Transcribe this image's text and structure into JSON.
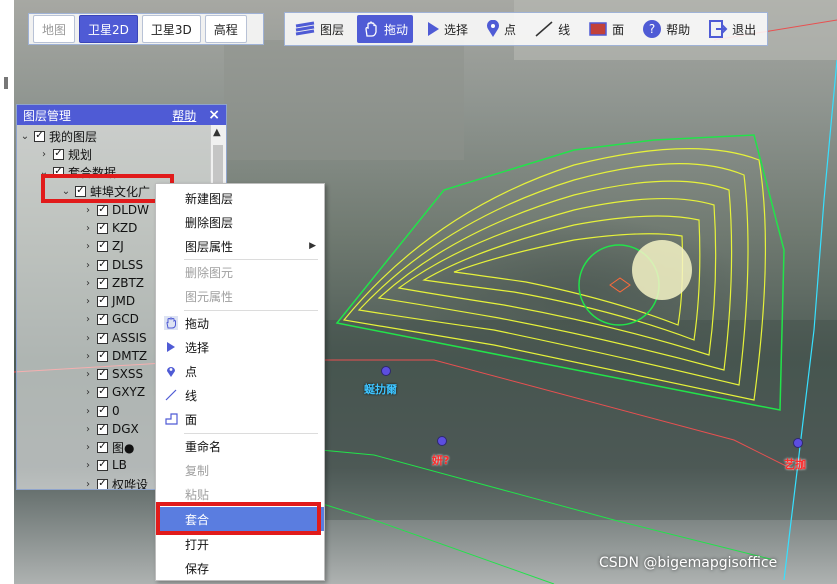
{
  "map_mode": {
    "items": [
      {
        "label": "地图",
        "state": "disabled"
      },
      {
        "label": "卫星2D",
        "state": "active"
      },
      {
        "label": "卫星3D",
        "state": "normal"
      },
      {
        "label": "高程",
        "state": "normal"
      }
    ]
  },
  "toolbar": {
    "layers_label": "图层",
    "pan_label": "拖动",
    "select_label": "选择",
    "point_label": "点",
    "line_label": "线",
    "area_label": "面",
    "help_label": "帮助",
    "exit_label": "退出"
  },
  "layer_panel": {
    "title": "图层管理",
    "help_label": "帮助",
    "close_label": "×",
    "tree": [
      {
        "label": "我的图层",
        "level": 0
      },
      {
        "label": "规划",
        "level": 1
      },
      {
        "label": "套合数据",
        "level": 1
      },
      {
        "label": "蚌埠文化广",
        "level": 2
      },
      {
        "label": "DLDW",
        "level": 3
      },
      {
        "label": "KZD",
        "level": 3
      },
      {
        "label": "ZJ",
        "level": 3
      },
      {
        "label": "DLSS",
        "level": 3
      },
      {
        "label": "ZBTZ",
        "level": 3
      },
      {
        "label": "JMD",
        "level": 3
      },
      {
        "label": "GCD",
        "level": 3
      },
      {
        "label": "ASSIS",
        "level": 3
      },
      {
        "label": "DMTZ",
        "level": 3
      },
      {
        "label": "SXSS",
        "level": 3
      },
      {
        "label": "GXYZ",
        "level": 3
      },
      {
        "label": "0",
        "level": 3
      },
      {
        "label": "DGX",
        "level": 3
      },
      {
        "label": "图●",
        "level": 3
      },
      {
        "label": "LB",
        "level": 3
      },
      {
        "label": "权哗设",
        "level": 3
      }
    ]
  },
  "context_menu": {
    "items": [
      {
        "label": "新建图层",
        "icon": "",
        "disabled": false,
        "submenu": false
      },
      {
        "label": "删除图层",
        "icon": "",
        "disabled": false,
        "submenu": false
      },
      {
        "label": "图层属性",
        "icon": "",
        "disabled": false,
        "submenu": true
      },
      {
        "label": "删除图元",
        "icon": "",
        "disabled": true,
        "submenu": false
      },
      {
        "label": "图元属性",
        "icon": "",
        "disabled": true,
        "submenu": false
      },
      {
        "label": "拖动",
        "icon": "pan-hand-icon",
        "disabled": false,
        "submenu": false
      },
      {
        "label": "选择",
        "icon": "select-arrow-icon",
        "disabled": false,
        "submenu": false
      },
      {
        "label": "点",
        "icon": "point-pin-icon",
        "disabled": false,
        "submenu": false
      },
      {
        "label": "线",
        "icon": "line-icon",
        "disabled": false,
        "submenu": false
      },
      {
        "label": "面",
        "icon": "polygon-icon",
        "disabled": false,
        "submenu": false
      },
      {
        "label": "重命名",
        "icon": "",
        "disabled": false,
        "submenu": false
      },
      {
        "label": "复制",
        "icon": "",
        "disabled": true,
        "submenu": false
      },
      {
        "label": "粘贴",
        "icon": "",
        "disabled": true,
        "submenu": false
      },
      {
        "label": "套合",
        "icon": "",
        "disabled": false,
        "submenu": false,
        "selected": true
      },
      {
        "label": "打开",
        "icon": "",
        "disabled": false,
        "submenu": false
      },
      {
        "label": "保存",
        "icon": "",
        "disabled": false,
        "submenu": false
      }
    ]
  },
  "map_labels": [
    {
      "text": "蜒扐爾",
      "color": "#3ec4ff"
    },
    {
      "text": "妍?",
      "color": "#ff2a2a"
    },
    {
      "text": "艺拁",
      "color": "#ff2a2a"
    }
  ],
  "watermark": "CSDN @bigemapgisoffice",
  "colors": {
    "accent": "#4f5bd5",
    "highlight_box": "#e11b1b",
    "contour": "#e6f23a",
    "boundary": "#22e34a"
  }
}
